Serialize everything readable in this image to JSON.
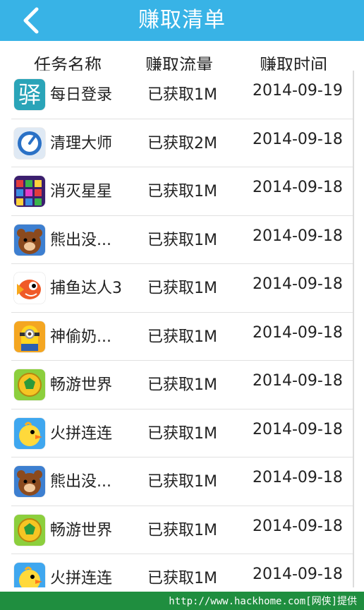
{
  "header": {
    "title": "赚取清单",
    "back_icon": "chevron-left-icon"
  },
  "columns": {
    "name": "任务名称",
    "flow": "赚取流量",
    "time": "赚取时间"
  },
  "rows": [
    {
      "name": "每日登录",
      "flow": "已获取1M",
      "date": "2014-09-19",
      "icon": "qiandao-icon",
      "icon_text": "驿"
    },
    {
      "name": "清理大师",
      "flow": "已获取2M",
      "date": "2014-09-18",
      "icon": "clean-master-icon"
    },
    {
      "name": "消灭星星",
      "flow": "已获取1M",
      "date": "2014-09-18",
      "icon": "popstar-icon"
    },
    {
      "name": "熊出没...",
      "flow": "已获取1M",
      "date": "2014-09-18",
      "icon": "bear-icon"
    },
    {
      "name": "捕鱼达人3",
      "flow": "已获取1M",
      "date": "2014-09-18",
      "icon": "fish-icon"
    },
    {
      "name": "神偷奶...",
      "flow": "已获取1M",
      "date": "2014-09-18",
      "icon": "minion-icon"
    },
    {
      "name": "畅游世界",
      "flow": "已获取1M",
      "date": "2014-09-18",
      "icon": "world-ball-icon"
    },
    {
      "name": "火拼连连",
      "flow": "已获取1M",
      "date": "2014-09-18",
      "icon": "chick-icon"
    },
    {
      "name": "熊出没...",
      "flow": "已获取1M",
      "date": "2014-09-18",
      "icon": "bear-icon"
    },
    {
      "name": "畅游世界",
      "flow": "已获取1M",
      "date": "2014-09-18",
      "icon": "world-ball-icon"
    },
    {
      "name": "火拼连连",
      "flow": "已获取1M",
      "date": "2014-09-18",
      "icon": "chick-icon"
    }
  ],
  "footer": {
    "watermark": "http://www.hackhome.com[网侠]提供"
  },
  "colors": {
    "header": "#38b3e6",
    "footer": "#1f8e3f"
  }
}
